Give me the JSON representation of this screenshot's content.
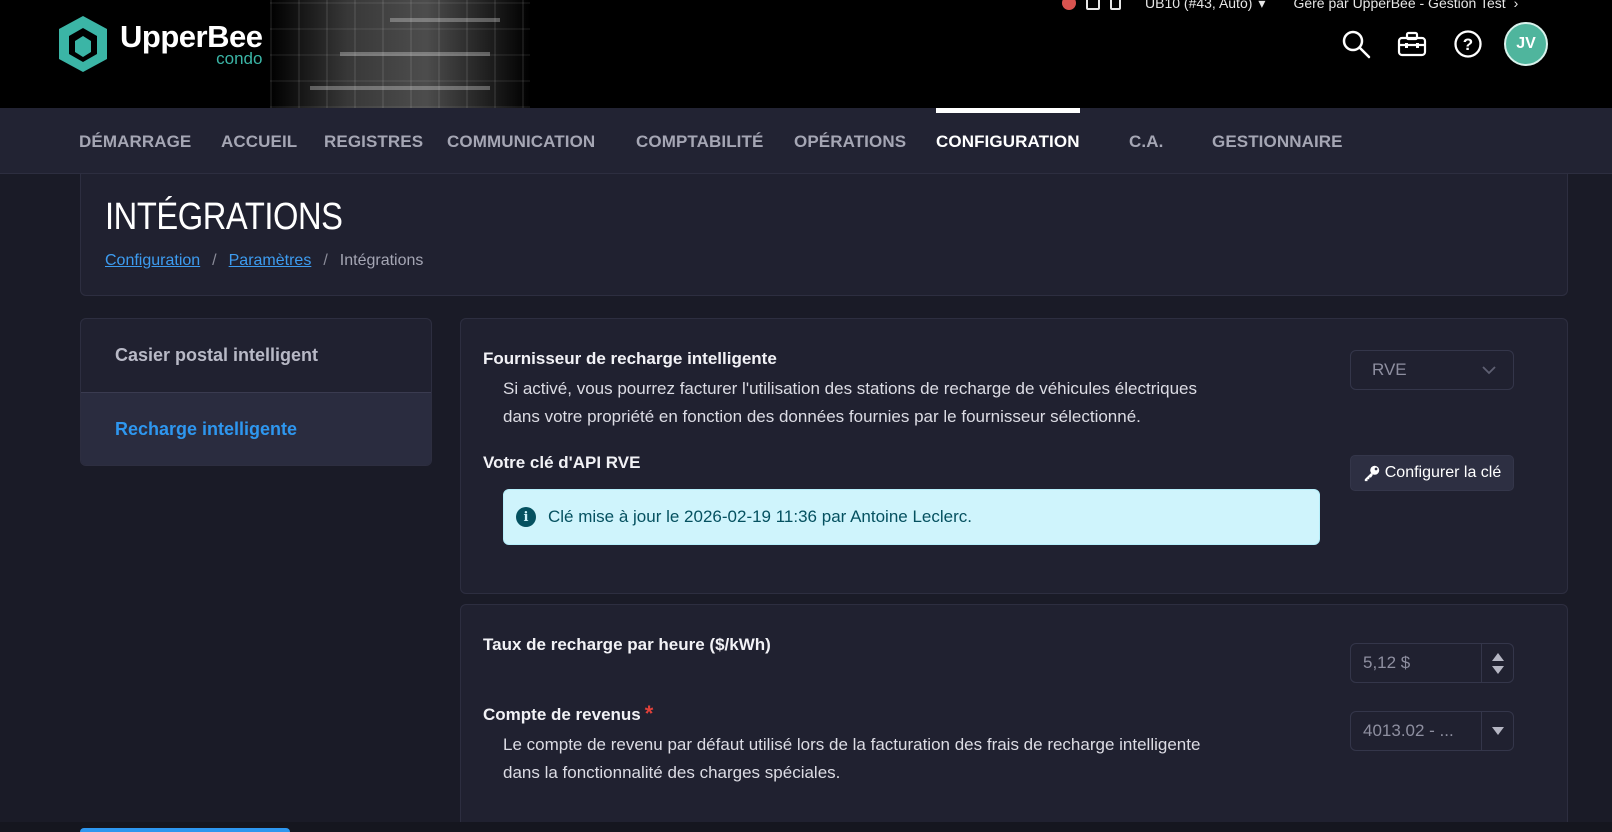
{
  "brand": {
    "name": "UpperBee",
    "sub": "condo",
    "hex_color": "#3bb5a6"
  },
  "topline": {
    "unit": "UB10 (#43, Auto)",
    "managed_by": "Géré par  UpperBee - Gestion Test"
  },
  "user": {
    "initials": "JV"
  },
  "nav": {
    "items": [
      "DÉMARRAGE",
      "ACCUEIL",
      "REGISTRES",
      "COMMUNICATION",
      "COMPTABILITÉ",
      "OPÉRATIONS",
      "CONFIGURATION",
      "C.A.",
      "GESTIONNAIRE"
    ],
    "active": "CONFIGURATION"
  },
  "page": {
    "title": "INTÉGRATIONS",
    "breadcrumb": [
      "Configuration",
      "Paramètres",
      "Intégrations"
    ]
  },
  "sidebar": {
    "items": [
      "Casier postal intelligent",
      "Recharge intelligente"
    ],
    "active": "Recharge intelligente"
  },
  "provider": {
    "label": "Fournisseur de recharge intelligente",
    "description_line1": "Si activé, vous pourrez facturer l'utilisation des stations de recharge de véhicules électriques",
    "description_line2": "dans votre propriété en fonction des données fournies par le fournisseur sélectionné.",
    "selected": "RVE"
  },
  "api_key": {
    "label": "Votre clé d'API RVE",
    "button_label": "Configurer la clé",
    "info": "Clé mise à jour le 2026-02-19 11:36 par Antoine Leclerc."
  },
  "rate": {
    "label": "Taux de recharge par heure ($/kWh)",
    "value": "5,12 $"
  },
  "revenue": {
    "label": "Compte de revenus",
    "required_mark": "*",
    "description_line1": "Le compte de revenu par défaut utilisé lors de la facturation des frais de recharge intelligente",
    "description_line2": "dans la fonctionnalité des charges spéciales.",
    "value": "4013.02 - ..."
  },
  "colors": {
    "background": "#1a1b27",
    "nav": "#222333",
    "card": "#202130",
    "accent": "#2e97ef",
    "info_bg": "#cff4fc",
    "info_text": "#055160"
  }
}
